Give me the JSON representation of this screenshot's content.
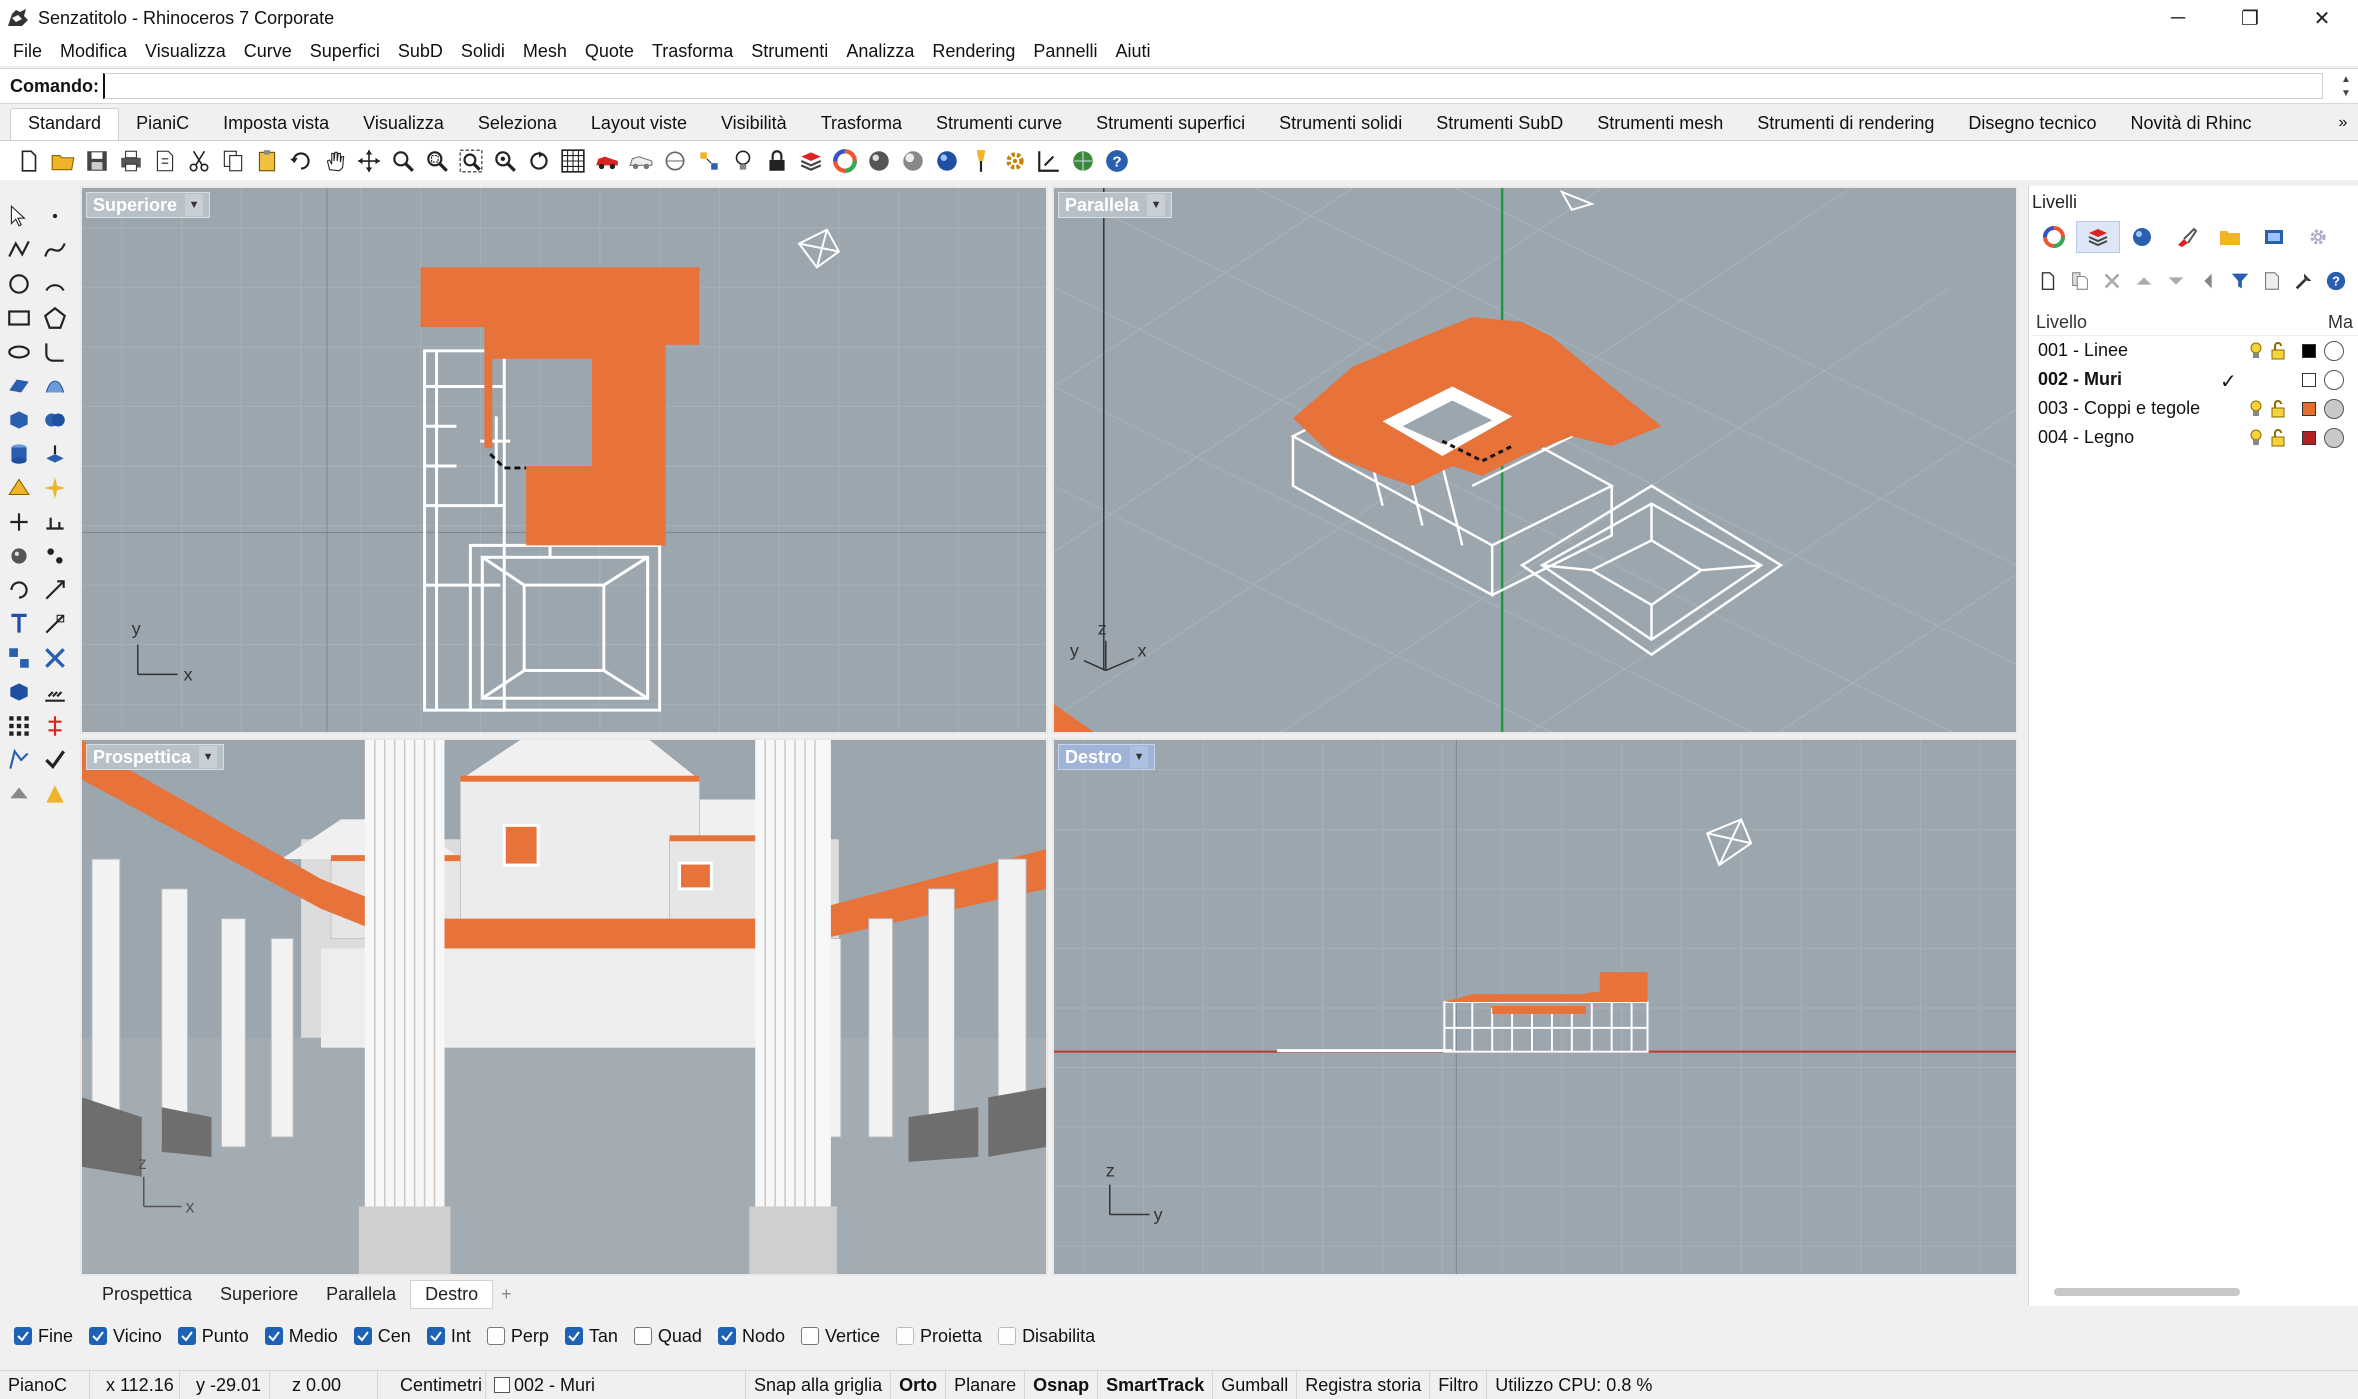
{
  "window": {
    "title": "Senzatitolo - Rhinoceros 7 Corporate",
    "minimize": "─",
    "maximize": "❐",
    "close": "✕"
  },
  "menu": [
    "File",
    "Modifica",
    "Visualizza",
    "Curve",
    "Superfici",
    "SubD",
    "Solidi",
    "Mesh",
    "Quote",
    "Trasforma",
    "Strumenti",
    "Analizza",
    "Rendering",
    "Pannelli",
    "Aiuti"
  ],
  "command": {
    "label": "Comando:",
    "value": ""
  },
  "toolbar_tabs": [
    "Standard",
    "PianiC",
    "Imposta vista",
    "Visualizza",
    "Seleziona",
    "Layout viste",
    "Visibilità",
    "Trasforma",
    "Strumenti curve",
    "Strumenti superfici",
    "Strumenti solidi",
    "Strumenti SubD",
    "Strumenti mesh",
    "Strumenti di rendering",
    "Disegno tecnico",
    "Novità di Rhinc"
  ],
  "toolbar_tabs_more": "»",
  "toolbar_icons": [
    "new-file-icon",
    "open-file-icon",
    "save-icon",
    "print-icon",
    "import-icon",
    "cut-icon",
    "copy-icon",
    "paste-icon",
    "undo-icon",
    "pan-hand-icon",
    "move-view-icon",
    "zoom-icon",
    "zoom-window-icon",
    "zoom-extents-icon",
    "zoom-selected-icon",
    "rotate-view-icon",
    "four-viewports-icon",
    "car-icon",
    "car-outline-icon",
    "circle-target-icon",
    "snap-icon",
    "bulb-icon",
    "lock-icon",
    "layer-icon",
    "color-wheel-icon",
    "sphere-grey-icon",
    "sphere-shaded-icon",
    "sphere-blue-icon",
    "light-icon",
    "gear-options-icon",
    "dimension-icon",
    "render-globe-icon",
    "help-icon"
  ],
  "viewports": {
    "top_left": {
      "label": "Superiore",
      "axis_x": "x",
      "axis_y": "y"
    },
    "top_right": {
      "label": "Parallela",
      "axis_x": "x",
      "axis_y": "y",
      "axis_z": "z"
    },
    "bottom_left": {
      "label": "Prospettica",
      "axis_x": "x",
      "axis_z": "z"
    },
    "bottom_right": {
      "label": "Destro",
      "axis_y": "y",
      "axis_z": "z"
    }
  },
  "viewport_tabs": [
    "Prospettica",
    "Superiore",
    "Parallela",
    "Destro"
  ],
  "viewport_tab_add": "+",
  "osnaps": [
    {
      "label": "Fine",
      "on": true
    },
    {
      "label": "Vicino",
      "on": true
    },
    {
      "label": "Punto",
      "on": true
    },
    {
      "label": "Medio",
      "on": true
    },
    {
      "label": "Cen",
      "on": true
    },
    {
      "label": "Int",
      "on": true
    },
    {
      "label": "Perp",
      "on": false
    },
    {
      "label": "Tan",
      "on": true
    },
    {
      "label": "Quad",
      "on": false
    },
    {
      "label": "Nodo",
      "on": true
    },
    {
      "label": "Vertice",
      "on": false
    },
    {
      "label": "Proietta",
      "on": false
    },
    {
      "label": "Disabilita",
      "on": false
    }
  ],
  "status": {
    "cplane": "PianoC",
    "x": "x 112.16",
    "y": "y -29.01",
    "z": "z 0.00",
    "units": "Centimetri",
    "layer": "002 - Muri",
    "snap": "Snap alla griglia",
    "ortho": "Orto",
    "planar": "Planare",
    "osnap": "Osnap",
    "smarttrack": "SmartTrack",
    "gumball": "Gumball",
    "history": "Registra storia",
    "filter": "Filtro",
    "cpu": "Utilizzo CPU: 0.8 %"
  },
  "layers_panel": {
    "title": "Livelli",
    "header_name": "Livello",
    "header_material": "Ma",
    "layers": [
      {
        "name": "001 - Linee",
        "current": false,
        "color": "#000000",
        "material": "#ffffff"
      },
      {
        "name": "002 - Muri",
        "current": true,
        "color": "#ffffff",
        "material": "#ffffff"
      },
      {
        "name": "003 - Coppi e tegole",
        "current": false,
        "color": "#e56d2d",
        "material": "#c8c8c8"
      },
      {
        "name": "004 - Legno",
        "current": false,
        "color": "#b22222",
        "material": "#c8c8c8"
      }
    ]
  },
  "colors": {
    "viewport_bg": "#9ba6ae",
    "roof_orange": "#e8733a",
    "active_blue": "#9fb4d8",
    "checkbox_blue": "#1e62b8"
  }
}
